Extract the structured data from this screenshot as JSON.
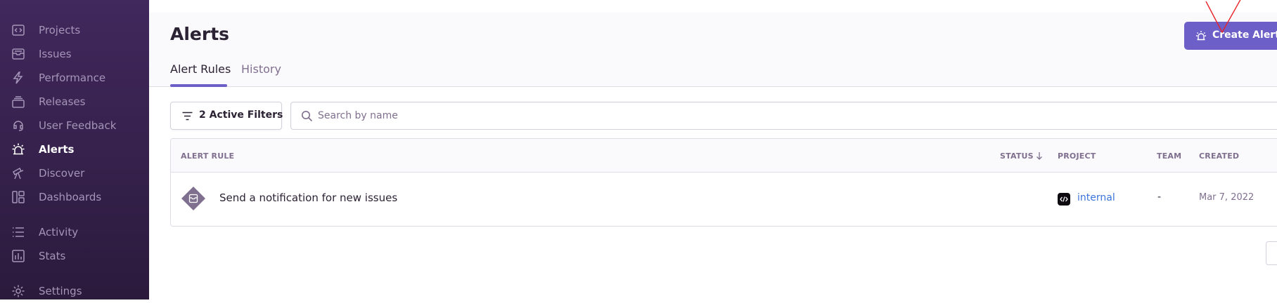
{
  "sidebar": {
    "items": [
      {
        "label": "Projects",
        "icon": "projects-icon"
      },
      {
        "label": "Issues",
        "icon": "issues-icon"
      },
      {
        "label": "Performance",
        "icon": "performance-icon"
      },
      {
        "label": "Releases",
        "icon": "releases-icon"
      },
      {
        "label": "User Feedback",
        "icon": "user-feedback-icon"
      },
      {
        "label": "Alerts",
        "icon": "alerts-icon",
        "active": true
      },
      {
        "label": "Discover",
        "icon": "discover-icon"
      },
      {
        "label": "Dashboards",
        "icon": "dashboards-icon"
      },
      {
        "label": "Activity",
        "icon": "activity-icon"
      },
      {
        "label": "Stats",
        "icon": "stats-icon"
      },
      {
        "label": "Settings",
        "icon": "settings-icon"
      }
    ]
  },
  "header": {
    "title": "Alerts",
    "create_button": "Create Alert",
    "tabs": [
      {
        "label": "Alert Rules",
        "active": true
      },
      {
        "label": "History",
        "active": false
      }
    ]
  },
  "filters": {
    "filter_button": "2 Active Filters",
    "search_placeholder": "Search by name",
    "search_value": ""
  },
  "table": {
    "columns": {
      "alert_rule": "ALERT RULE",
      "status": "STATUS",
      "project": "PROJECT",
      "team": "TEAM",
      "created": "CREATED"
    },
    "rows": [
      {
        "name": "Send a notification for new issues",
        "project": "internal",
        "team": "-",
        "created": "Mar 7, 2022"
      }
    ]
  },
  "colors": {
    "accent": "#6c5fc7",
    "sidebar_bg": "#3a2453",
    "link": "#3d74db",
    "annotation": "#e8242b"
  }
}
